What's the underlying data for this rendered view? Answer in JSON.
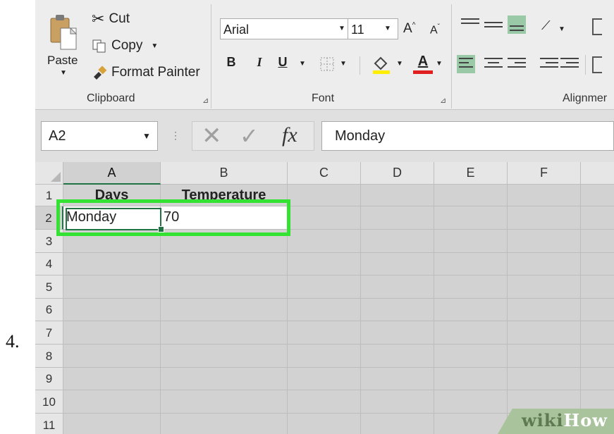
{
  "step_number": "4.",
  "ribbon": {
    "clipboard": {
      "paste_label": "Paste",
      "cut_label": "Cut",
      "copy_label": "Copy",
      "format_painter_label": "Format Painter",
      "group_label": "Clipboard"
    },
    "font": {
      "font_name": "Arial",
      "font_size": "11",
      "bold_label": "B",
      "italic_label": "I",
      "underline_label": "U",
      "grow_label": "A",
      "shrink_label": "A",
      "font_color_label": "A",
      "group_label": "Font"
    },
    "alignment": {
      "group_label": "Alignmer"
    }
  },
  "formula_bar": {
    "name_box": "A2",
    "fx_label": "fx",
    "content": "Monday"
  },
  "columns": [
    "A",
    "B",
    "C",
    "D",
    "E",
    "F"
  ],
  "rows": [
    "1",
    "2",
    "3",
    "4",
    "5",
    "6",
    "7",
    "8",
    "9",
    "10",
    "11"
  ],
  "cells": {
    "A1": "Days",
    "B1": "Temperature",
    "A2": "Monday",
    "B2": "70"
  },
  "watermark": {
    "part1": "wiki",
    "part2": "How"
  },
  "colors": {
    "highlight": "#33e233",
    "accent": "#217346",
    "font_color_bar": "#e02020",
    "fill_color_bar": "#ffee00"
  }
}
